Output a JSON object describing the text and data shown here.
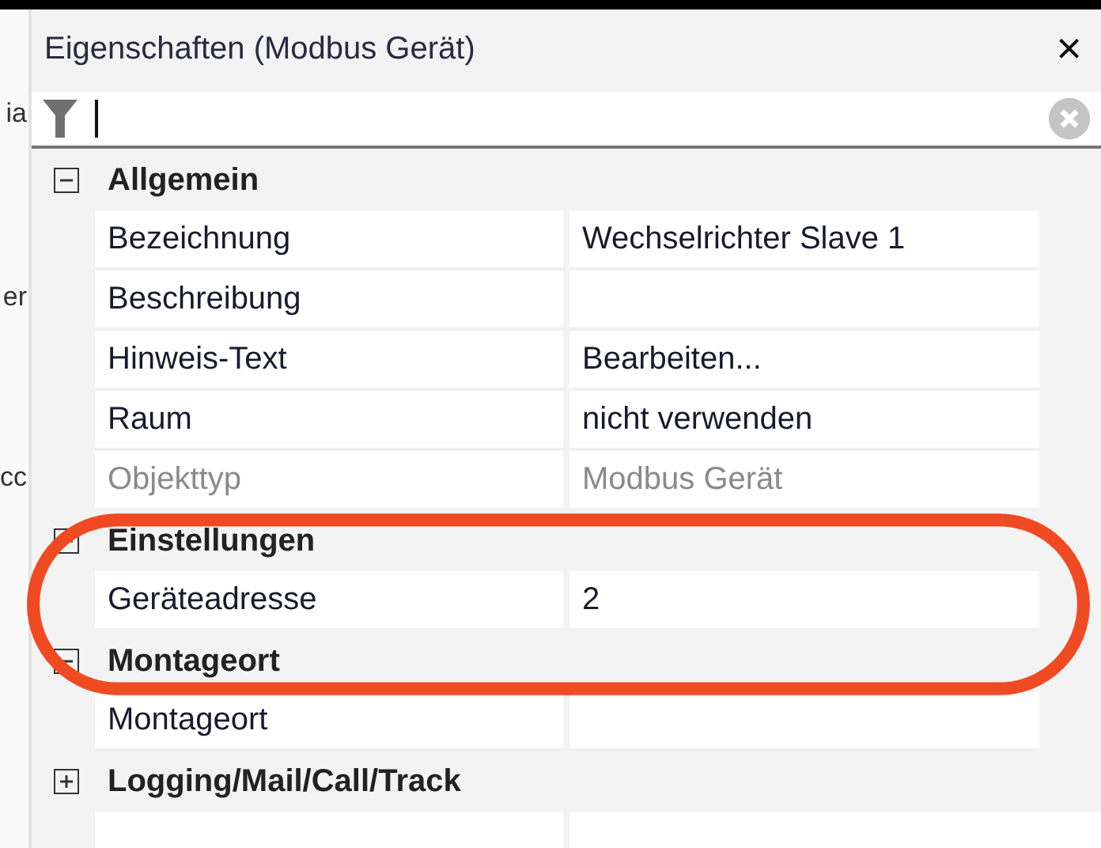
{
  "left_panel": {
    "fragments": [
      "ia",
      "er",
      "cc"
    ]
  },
  "panel": {
    "title": "Eigenschaften (Modbus Gerät)",
    "close": "×"
  },
  "groups": [
    {
      "label": "Allgemein",
      "expanded": true,
      "children": [
        {
          "name": "Bezeichnung",
          "value": "Wechselrichter Slave 1",
          "disabled": false
        },
        {
          "name": "Beschreibung",
          "disabled": false
        },
        {
          "name": "Hinweis-Text",
          "value": "Bearbeiten...",
          "disabled": false
        },
        {
          "name": "Raum",
          "value": "nicht verwenden",
          "disabled": false
        },
        {
          "name": "Objekttyp",
          "value": "Modbus Gerät",
          "disabled": true
        }
      ]
    },
    {
      "label": "Einstellungen",
      "expanded": true,
      "children": [
        {
          "name": "Geräteadresse",
          "value": "2",
          "disabled": false
        }
      ]
    },
    {
      "label": "Montageort",
      "expanded": true,
      "children": [
        {
          "name": "Montageort",
          "disabled": false
        }
      ]
    },
    {
      "label": "Logging/Mail/Call/Track",
      "expanded": false
    }
  ],
  "annotation": {
    "kind": "ellipse"
  }
}
